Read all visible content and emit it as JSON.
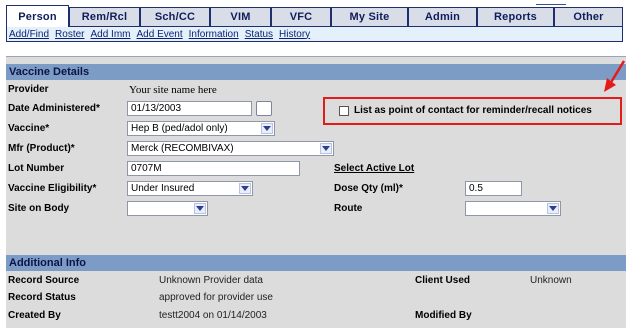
{
  "tabs": [
    {
      "label": "Person",
      "active": true
    },
    {
      "label": "Rem/Rcl"
    },
    {
      "label": "Sch/CC"
    },
    {
      "label": "VIM"
    },
    {
      "label": "VFC"
    },
    {
      "label": "My Site"
    },
    {
      "label": "Admin"
    },
    {
      "label": "Reports"
    },
    {
      "label": "Other"
    }
  ],
  "subnav": [
    "Add/Find",
    "Roster",
    "Add Imm",
    "Add Event",
    "Information",
    "Status",
    "History"
  ],
  "vaccine_details": {
    "header": "Vaccine Details",
    "provider_label": "Provider",
    "provider_value": "Your site name here",
    "date_label": "Date Administered*",
    "date_value": "01/13/2003",
    "contact_checkbox_label": "List as point of contact for reminder/recall notices",
    "vaccine_label": "Vaccine*",
    "vaccine_value": "Hep B (ped/adol only)",
    "mfr_label": "Mfr (Product)*",
    "mfr_value": "Merck (RECOMBIVAX)",
    "lot_label": "Lot Number",
    "lot_value": "0707M",
    "select_lot_link": "Select Active Lot",
    "eligibility_label": "Vaccine Eligibility*",
    "eligibility_value": "Under Insured",
    "dose_label": "Dose Qty (ml)*",
    "dose_value": "0.5",
    "site_label": "Site on Body",
    "site_value": "",
    "route_label": "Route",
    "route_value": ""
  },
  "additional_info": {
    "header": "Additional Info",
    "record_source_label": "Record Source",
    "record_source_value": "Unknown Provider data",
    "record_status_label": "Record Status",
    "record_status_value": "approved for provider use",
    "created_by_label": "Created By",
    "created_by_value": "testt2004 on 01/14/2003",
    "client_used_label": "Client Used",
    "client_used_value": "Unknown",
    "modified_by_label": "Modified By",
    "modified_by_value": ""
  },
  "colors": {
    "section_header": "#7c9cc6",
    "panel_bg": "#dcdcdc",
    "callout": "#e31b1b",
    "tab_bg": "#d8dde8"
  }
}
